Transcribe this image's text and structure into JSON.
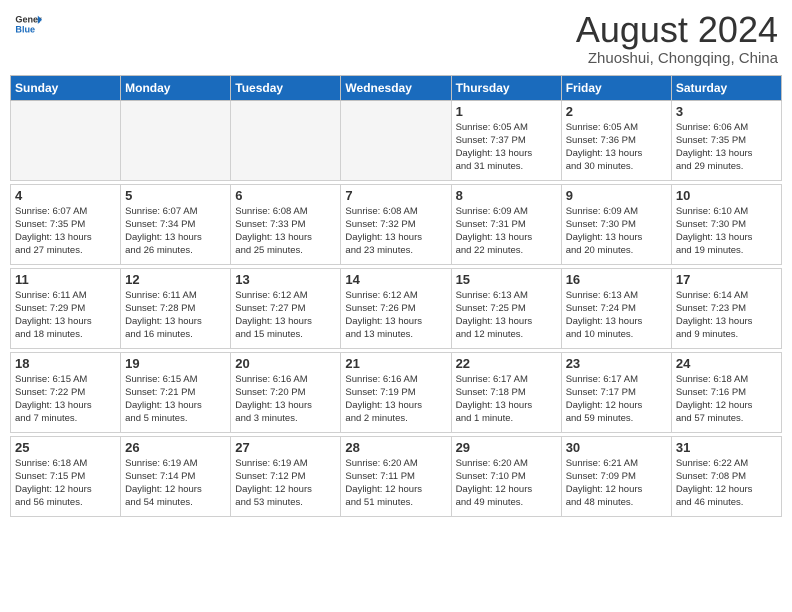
{
  "logo": {
    "line1": "General",
    "line2": "Blue"
  },
  "title": "August 2024",
  "subtitle": "Zhuoshui, Chongqing, China",
  "days_of_week": [
    "Sunday",
    "Monday",
    "Tuesday",
    "Wednesday",
    "Thursday",
    "Friday",
    "Saturday"
  ],
  "weeks": [
    [
      {
        "num": "",
        "info": ""
      },
      {
        "num": "",
        "info": ""
      },
      {
        "num": "",
        "info": ""
      },
      {
        "num": "",
        "info": ""
      },
      {
        "num": "1",
        "info": "Sunrise: 6:05 AM\nSunset: 7:37 PM\nDaylight: 13 hours\nand 31 minutes."
      },
      {
        "num": "2",
        "info": "Sunrise: 6:05 AM\nSunset: 7:36 PM\nDaylight: 13 hours\nand 30 minutes."
      },
      {
        "num": "3",
        "info": "Sunrise: 6:06 AM\nSunset: 7:35 PM\nDaylight: 13 hours\nand 29 minutes."
      }
    ],
    [
      {
        "num": "4",
        "info": "Sunrise: 6:07 AM\nSunset: 7:35 PM\nDaylight: 13 hours\nand 27 minutes."
      },
      {
        "num": "5",
        "info": "Sunrise: 6:07 AM\nSunset: 7:34 PM\nDaylight: 13 hours\nand 26 minutes."
      },
      {
        "num": "6",
        "info": "Sunrise: 6:08 AM\nSunset: 7:33 PM\nDaylight: 13 hours\nand 25 minutes."
      },
      {
        "num": "7",
        "info": "Sunrise: 6:08 AM\nSunset: 7:32 PM\nDaylight: 13 hours\nand 23 minutes."
      },
      {
        "num": "8",
        "info": "Sunrise: 6:09 AM\nSunset: 7:31 PM\nDaylight: 13 hours\nand 22 minutes."
      },
      {
        "num": "9",
        "info": "Sunrise: 6:09 AM\nSunset: 7:30 PM\nDaylight: 13 hours\nand 20 minutes."
      },
      {
        "num": "10",
        "info": "Sunrise: 6:10 AM\nSunset: 7:30 PM\nDaylight: 13 hours\nand 19 minutes."
      }
    ],
    [
      {
        "num": "11",
        "info": "Sunrise: 6:11 AM\nSunset: 7:29 PM\nDaylight: 13 hours\nand 18 minutes."
      },
      {
        "num": "12",
        "info": "Sunrise: 6:11 AM\nSunset: 7:28 PM\nDaylight: 13 hours\nand 16 minutes."
      },
      {
        "num": "13",
        "info": "Sunrise: 6:12 AM\nSunset: 7:27 PM\nDaylight: 13 hours\nand 15 minutes."
      },
      {
        "num": "14",
        "info": "Sunrise: 6:12 AM\nSunset: 7:26 PM\nDaylight: 13 hours\nand 13 minutes."
      },
      {
        "num": "15",
        "info": "Sunrise: 6:13 AM\nSunset: 7:25 PM\nDaylight: 13 hours\nand 12 minutes."
      },
      {
        "num": "16",
        "info": "Sunrise: 6:13 AM\nSunset: 7:24 PM\nDaylight: 13 hours\nand 10 minutes."
      },
      {
        "num": "17",
        "info": "Sunrise: 6:14 AM\nSunset: 7:23 PM\nDaylight: 13 hours\nand 9 minutes."
      }
    ],
    [
      {
        "num": "18",
        "info": "Sunrise: 6:15 AM\nSunset: 7:22 PM\nDaylight: 13 hours\nand 7 minutes."
      },
      {
        "num": "19",
        "info": "Sunrise: 6:15 AM\nSunset: 7:21 PM\nDaylight: 13 hours\nand 5 minutes."
      },
      {
        "num": "20",
        "info": "Sunrise: 6:16 AM\nSunset: 7:20 PM\nDaylight: 13 hours\nand 3 minutes."
      },
      {
        "num": "21",
        "info": "Sunrise: 6:16 AM\nSunset: 7:19 PM\nDaylight: 13 hours\nand 2 minutes."
      },
      {
        "num": "22",
        "info": "Sunrise: 6:17 AM\nSunset: 7:18 PM\nDaylight: 13 hours\nand 1 minute."
      },
      {
        "num": "23",
        "info": "Sunrise: 6:17 AM\nSunset: 7:17 PM\nDaylight: 12 hours\nand 59 minutes."
      },
      {
        "num": "24",
        "info": "Sunrise: 6:18 AM\nSunset: 7:16 PM\nDaylight: 12 hours\nand 57 minutes."
      }
    ],
    [
      {
        "num": "25",
        "info": "Sunrise: 6:18 AM\nSunset: 7:15 PM\nDaylight: 12 hours\nand 56 minutes."
      },
      {
        "num": "26",
        "info": "Sunrise: 6:19 AM\nSunset: 7:14 PM\nDaylight: 12 hours\nand 54 minutes."
      },
      {
        "num": "27",
        "info": "Sunrise: 6:19 AM\nSunset: 7:12 PM\nDaylight: 12 hours\nand 53 minutes."
      },
      {
        "num": "28",
        "info": "Sunrise: 6:20 AM\nSunset: 7:11 PM\nDaylight: 12 hours\nand 51 minutes."
      },
      {
        "num": "29",
        "info": "Sunrise: 6:20 AM\nSunset: 7:10 PM\nDaylight: 12 hours\nand 49 minutes."
      },
      {
        "num": "30",
        "info": "Sunrise: 6:21 AM\nSunset: 7:09 PM\nDaylight: 12 hours\nand 48 minutes."
      },
      {
        "num": "31",
        "info": "Sunrise: 6:22 AM\nSunset: 7:08 PM\nDaylight: 12 hours\nand 46 minutes."
      }
    ]
  ]
}
